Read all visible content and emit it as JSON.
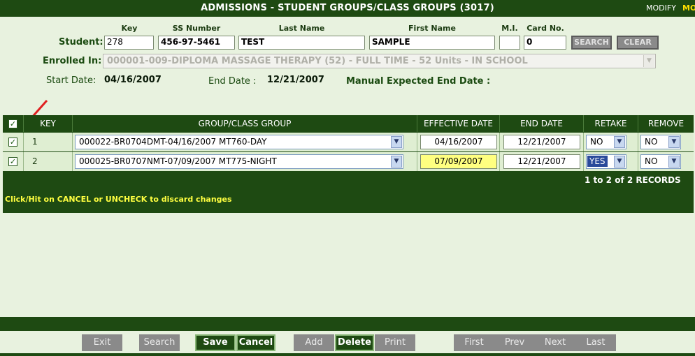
{
  "title": "ADMISSIONS - STUDENT GROUPS/CLASS GROUPS (3017)",
  "mode_label": "MODIFY",
  "mode_label2": "MO",
  "student": {
    "label": "Student:",
    "headers": {
      "key": "Key",
      "ss": "SS Number",
      "last": "Last Name",
      "first": "First Name",
      "mi": "M.I.",
      "card": "Card No."
    },
    "key": "278",
    "ss_number": "456-97-5461",
    "last_name": "TEST",
    "first_name": "SAMPLE",
    "mi": "",
    "card_no": "0",
    "search_label": "SEARCH",
    "clear_label": "CLEAR"
  },
  "enrolled": {
    "label": "Enrolled In:",
    "value": "000001-009-DIPLOMA MASSAGE THERAPY (52) - FULL TIME - 52 Units - IN SCHOOL"
  },
  "dates": {
    "start_label": "Start Date:",
    "start_value": "04/16/2007",
    "end_label": "End Date :",
    "end_value": "12/21/2007",
    "manual_label": "Manual Expected End Date :"
  },
  "grid": {
    "headers": {
      "key": "KEY",
      "group": "GROUP/CLASS GROUP",
      "effective": "EFFECTIVE DATE",
      "end": "END DATE",
      "retake": "RETAKE",
      "remove": "REMOVE"
    },
    "rows": [
      {
        "key": "1",
        "group": "000022-BR0704DMT-04/16/2007 MT760-DAY",
        "effective": "04/16/2007",
        "end": "12/21/2007",
        "retake": "NO",
        "remove": "NO"
      },
      {
        "key": "2",
        "group": "000025-BR0707NMT-07/09/2007 MT775-NIGHT",
        "effective": "07/09/2007",
        "end": "12/21/2007",
        "retake": "YES",
        "remove": "NO"
      }
    ],
    "records": "1 to 2 of 2 RECORDS",
    "hint": "Click/Hit on CANCEL or UNCHECK to discard changes"
  },
  "buttons": {
    "exit": "Exit",
    "search": "Search",
    "save": "Save",
    "cancel": "Cancel",
    "add": "Add",
    "delete": "Delete",
    "print": "Print",
    "first": "First",
    "prev": "Prev",
    "next": "Next",
    "last": "Last"
  },
  "colors": {
    "primary": "#1e4a12",
    "background": "#e8f2df",
    "row": "#dfeed2",
    "highlight": "#ffff80",
    "hint": "#ffff40",
    "arrow": "#e02020"
  }
}
